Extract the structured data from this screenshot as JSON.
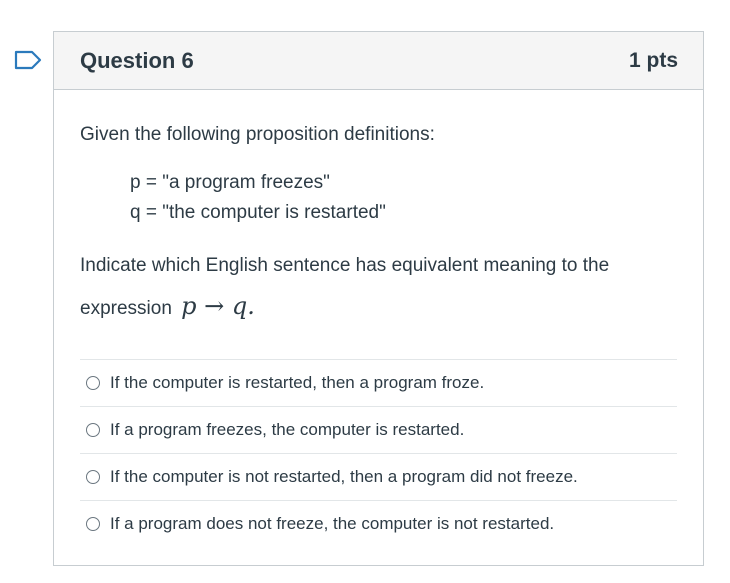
{
  "question": {
    "title": "Question 6",
    "points": "1 pts",
    "intro": "Given the following proposition definitions:",
    "definitions": [
      "p = \"a program freezes\"",
      "q = \"the computer is restarted\""
    ],
    "prompt_line1": "Indicate which English sentence has equivalent meaning to the",
    "prompt_line2": "expression",
    "expression": "p → q."
  },
  "answers": [
    "If the computer is restarted, then a program froze.",
    "If a program freezes, the computer is restarted.",
    "If the computer is not restarted, then a program did not freeze.",
    "If a program does not freeze, the computer is not restarted."
  ],
  "colors": {
    "flag": "#2b7abc",
    "border": "#c7cdd1",
    "header_bg": "#f5f5f5",
    "text": "#2d3b45"
  },
  "icons": {
    "flag": "flag-question-icon"
  }
}
